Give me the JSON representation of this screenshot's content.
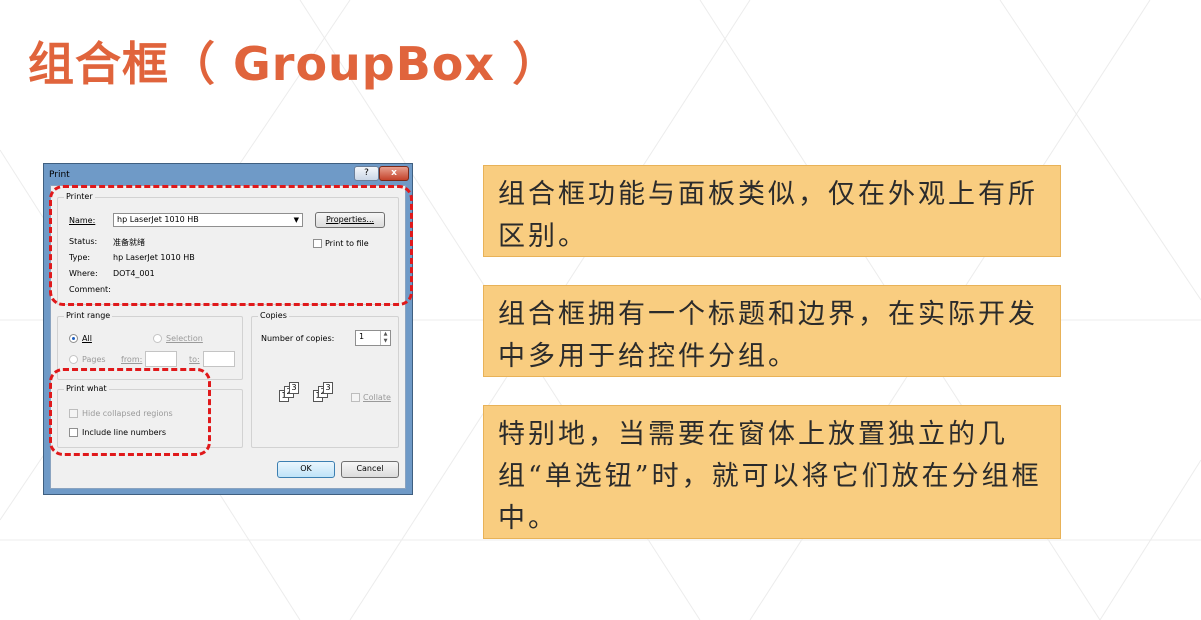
{
  "slide": {
    "title": "组合框（ GroupBox ）",
    "accent_color": "#e0643c",
    "note_color": "#f9cd80"
  },
  "dialog": {
    "title": "Print",
    "help_label": "?",
    "close_label": "x",
    "printer_group": {
      "caption": "Printer",
      "name_label": "Name:",
      "name_value": "hp LaserJet 1010 HB",
      "properties_label": "Properties...",
      "status_label": "Status:",
      "status_value": "准备就绪",
      "type_label": "Type:",
      "type_value": "hp LaserJet 1010 HB",
      "where_label": "Where:",
      "where_value": "DOT4_001",
      "comment_label": "Comment:",
      "print_to_file_label": "Print to file"
    },
    "print_range_group": {
      "caption": "Print range",
      "all_label": "All",
      "selection_label": "Selection",
      "pages_label": "Pages",
      "from_label": "from:",
      "to_label": "to:"
    },
    "copies_group": {
      "caption": "Copies",
      "number_label": "Number of copies:",
      "number_value": "1",
      "collate_label": "Collate",
      "collate_pages": [
        "1",
        "2",
        "3"
      ]
    },
    "print_what_group": {
      "caption": "Print what",
      "hide_collapsed_label": "Hide collapsed regions",
      "include_line_numbers_label": "Include line numbers"
    },
    "ok_label": "OK",
    "cancel_label": "Cancel"
  },
  "notes": [
    "组合框功能与面板类似，仅在外观上有所区别。",
    "组合框拥有一个标题和边界，在实际开发中多用于给控件分组。",
    "特别地，当需要在窗体上放置独立的几组“单选钮”时，就可以将它们放在分组框中。"
  ]
}
